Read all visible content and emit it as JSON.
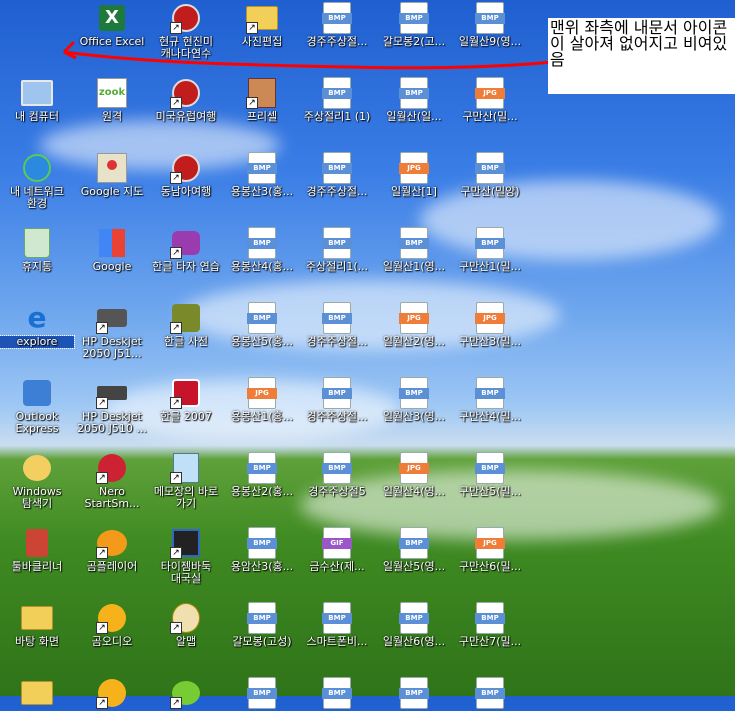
{
  "note": "맨위 좌측에 내문서 아이콘이 살아져 없어지고 비여있음",
  "icons": [
    {
      "label": "Office Excel",
      "kind": "excel",
      "col": 0,
      "row": 0
    },
    {
      "label": "현규 현진미 캐나다연수",
      "kind": "media",
      "col": 1,
      "row": 0
    },
    {
      "label": "사진편집",
      "kind": "folder",
      "col": 2,
      "row": 0
    },
    {
      "label": "경주주상절...",
      "kind": "bmp",
      "col": 3,
      "row": 0
    },
    {
      "label": "갈모봉2(고...",
      "kind": "bmp",
      "col": 4,
      "row": 0
    },
    {
      "label": "일월산9(영...",
      "kind": "bmp",
      "col": 5,
      "row": 0
    },
    {
      "label": "내 컴퓨터",
      "kind": "computer",
      "col": -1,
      "row": 1
    },
    {
      "label": "원격",
      "kind": "zook",
      "col": 0,
      "row": 1
    },
    {
      "label": "미국유럽여행",
      "kind": "media",
      "col": 1,
      "row": 1
    },
    {
      "label": "프리셀",
      "kind": "freecell",
      "col": 2,
      "row": 1
    },
    {
      "label": "주상절리1 (1)",
      "kind": "bmp",
      "col": 3,
      "row": 1
    },
    {
      "label": "일월산(일...",
      "kind": "bmp",
      "col": 4,
      "row": 1
    },
    {
      "label": "구만산(밀...",
      "kind": "jpg",
      "col": 5,
      "row": 1
    },
    {
      "label": "내 네트워크 환경",
      "kind": "network",
      "col": -1,
      "row": 2
    },
    {
      "label": "Google 지도",
      "kind": "gmaps",
      "col": 0,
      "row": 2
    },
    {
      "label": "동남아여행",
      "kind": "media",
      "col": 1,
      "row": 2
    },
    {
      "label": "용봉산3(홍...",
      "kind": "bmp",
      "col": 2,
      "row": 2
    },
    {
      "label": "경주주상절...",
      "kind": "bmp",
      "col": 3,
      "row": 2
    },
    {
      "label": "일월산[1]",
      "kind": "jpg",
      "col": 4,
      "row": 2
    },
    {
      "label": "구만산(밀양)",
      "kind": "bmp",
      "col": 5,
      "row": 2
    },
    {
      "label": "휴지통",
      "kind": "recycle",
      "col": -1,
      "row": 3
    },
    {
      "label": "Google",
      "kind": "google",
      "col": 0,
      "row": 3
    },
    {
      "label": "한글 타자 연습",
      "kind": "typing",
      "col": 1,
      "row": 3
    },
    {
      "label": "용봉산4(홍...",
      "kind": "bmp",
      "col": 2,
      "row": 3
    },
    {
      "label": "주상절리1(...",
      "kind": "bmp",
      "col": 3,
      "row": 3
    },
    {
      "label": "일월산1(영...",
      "kind": "bmp",
      "col": 4,
      "row": 3
    },
    {
      "label": "구만산1(밀...",
      "kind": "bmp",
      "col": 5,
      "row": 3
    },
    {
      "label": "explore",
      "kind": "ie",
      "col": -1,
      "row": 4
    },
    {
      "label": "HP Deskjet 2050 J51...",
      "kind": "printer",
      "col": 0,
      "row": 4
    },
    {
      "label": "한글 사전",
      "kind": "dict",
      "col": 1,
      "row": 4
    },
    {
      "label": "용봉산5(홍...",
      "kind": "bmp",
      "col": 2,
      "row": 4
    },
    {
      "label": "경주주상절...",
      "kind": "bmp",
      "col": 3,
      "row": 4
    },
    {
      "label": "일월산2(영...",
      "kind": "jpg",
      "col": 4,
      "row": 4
    },
    {
      "label": "구만산3(밀...",
      "kind": "jpg",
      "col": 5,
      "row": 4
    },
    {
      "label": "Outlook Express",
      "kind": "outlook",
      "col": -1,
      "row": 5
    },
    {
      "label": "HP Deskjet 2050 J510 ...",
      "kind": "scanner",
      "col": 0,
      "row": 5
    },
    {
      "label": "한글 2007",
      "kind": "hwp",
      "col": 1,
      "row": 5
    },
    {
      "label": "용봉산1(홍...",
      "kind": "jpg",
      "col": 2,
      "row": 5
    },
    {
      "label": "경주주상절...",
      "kind": "bmp",
      "col": 3,
      "row": 5
    },
    {
      "label": "일월산3(영...",
      "kind": "bmp",
      "col": 4,
      "row": 5
    },
    {
      "label": "구만산4(밀...",
      "kind": "bmp",
      "col": 5,
      "row": 5
    },
    {
      "label": "Windows 탐색기",
      "kind": "explorer",
      "col": -1,
      "row": 6
    },
    {
      "label": "Nero StartSm...",
      "kind": "nero",
      "col": 0,
      "row": 6
    },
    {
      "label": "메모장의 바로 가기",
      "kind": "notepad",
      "col": 1,
      "row": 6
    },
    {
      "label": "용봉산2(홍...",
      "kind": "bmp",
      "col": 2,
      "row": 6
    },
    {
      "label": "경주주상절5",
      "kind": "bmp",
      "col": 3,
      "row": 6
    },
    {
      "label": "일월산4(영...",
      "kind": "jpg",
      "col": 4,
      "row": 6
    },
    {
      "label": "구만산5(밀...",
      "kind": "bmp",
      "col": 5,
      "row": 6
    },
    {
      "label": "툴바클리너",
      "kind": "toolbar",
      "col": -1,
      "row": 7
    },
    {
      "label": "곰플레이어",
      "kind": "gom",
      "col": 0,
      "row": 7
    },
    {
      "label": "타이젬바둑 대국실",
      "kind": "baduk",
      "col": 1,
      "row": 7
    },
    {
      "label": "용암산3(홍...",
      "kind": "bmp",
      "col": 2,
      "row": 7
    },
    {
      "label": "금수산(제...",
      "kind": "gif",
      "col": 3,
      "row": 7
    },
    {
      "label": "일월산5(영...",
      "kind": "bmp",
      "col": 4,
      "row": 7
    },
    {
      "label": "구만산6(밀...",
      "kind": "jpg",
      "col": 5,
      "row": 7
    },
    {
      "label": "바탕 화면",
      "kind": "folder",
      "col": -1,
      "row": 8
    },
    {
      "label": "곰오디오",
      "kind": "gomaudio",
      "col": 0,
      "row": 8
    },
    {
      "label": "알맵",
      "kind": "almap",
      "col": 1,
      "row": 8
    },
    {
      "label": "갈모봉(고성)",
      "kind": "bmp",
      "col": 2,
      "row": 8
    },
    {
      "label": "스마트폰비...",
      "kind": "bmp",
      "col": 3,
      "row": 8
    },
    {
      "label": "일월산6(영...",
      "kind": "bmp",
      "col": 4,
      "row": 8
    },
    {
      "label": "구만산7(밀...",
      "kind": "bmp",
      "col": 5,
      "row": 8
    },
    {
      "label": "",
      "kind": "folder",
      "col": -1,
      "row": 9
    },
    {
      "label": "",
      "kind": "gomaudio",
      "col": 0,
      "row": 9
    },
    {
      "label": "",
      "kind": "frog",
      "col": 1,
      "row": 9
    },
    {
      "label": "",
      "kind": "bmp",
      "col": 2,
      "row": 9
    },
    {
      "label": "",
      "kind": "bmp",
      "col": 3,
      "row": 9
    },
    {
      "label": "",
      "kind": "bmp",
      "col": 4,
      "row": 9
    },
    {
      "label": "",
      "kind": "bmp",
      "col": 5,
      "row": 9
    }
  ]
}
